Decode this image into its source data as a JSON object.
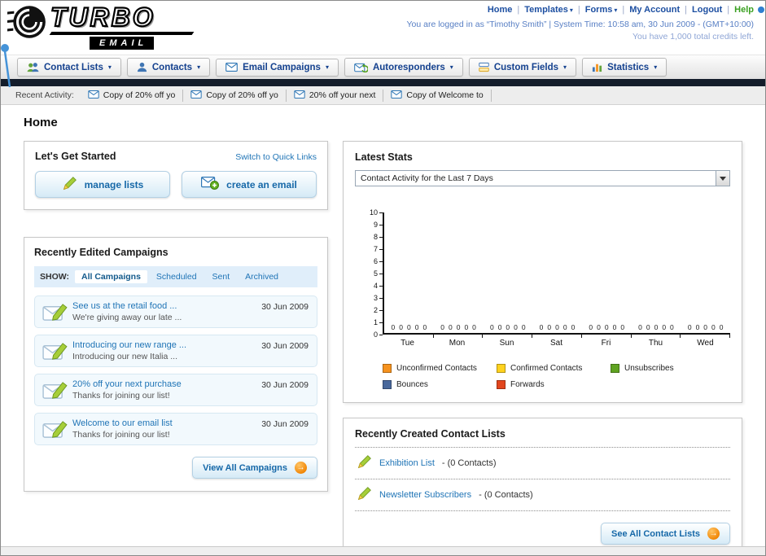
{
  "icons": {
    "caret_down": "▾",
    "arrow_right": "→"
  },
  "header": {
    "logo_line1": "TURBO",
    "logo_line2": "EMAIL",
    "nav_links": [
      "Home",
      "Templates",
      "Forms",
      "My Account",
      "Logout",
      "Help"
    ],
    "login_status": "You are logged in as “Timothy Smith” | System Time: 10:58 am, 30 Jun 2009 - (GMT+10:00)",
    "credits": "You have 1,000 total credits left."
  },
  "nav_tabs": [
    {
      "label": "Contact Lists"
    },
    {
      "label": "Contacts"
    },
    {
      "label": "Email Campaigns"
    },
    {
      "label": "Autoresponders"
    },
    {
      "label": "Custom Fields"
    },
    {
      "label": "Statistics"
    }
  ],
  "recent_activity": {
    "label": "Recent Activity:",
    "items": [
      "Copy of 20% off yo",
      "Copy of 20% off yo",
      "20% off your next",
      "Copy of Welcome to"
    ]
  },
  "page_title": "Home",
  "get_started": {
    "title": "Let's Get Started",
    "switch_link": "Switch to Quick Links",
    "manage_lists": "manage lists",
    "create_email": "create an email"
  },
  "campaigns": {
    "title": "Recently Edited Campaigns",
    "show_label": "SHOW:",
    "filters": [
      {
        "label": "All Campaigns",
        "active": true
      },
      {
        "label": "Scheduled",
        "active": false
      },
      {
        "label": "Sent",
        "active": false
      },
      {
        "label": "Archived",
        "active": false
      }
    ],
    "items": [
      {
        "title": "See us at the retail food ...",
        "subtitle": "We're giving away our late ...",
        "date": "30 Jun 2009"
      },
      {
        "title": "Introducing our new range ...",
        "subtitle": "Introducing our new Italia ...",
        "date": "30 Jun 2009"
      },
      {
        "title": "20% off your next purchase",
        "subtitle": "Thanks for joining our list!",
        "date": "30 Jun 2009"
      },
      {
        "title": "Welcome to our email list",
        "subtitle": "Thanks for joining our list!",
        "date": "30 Jun 2009"
      }
    ],
    "view_all_label": "View All Campaigns"
  },
  "stats": {
    "title": "Latest Stats",
    "dropdown_value": "Contact Activity for the Last 7 Days",
    "chart_data": {
      "type": "bar",
      "title": "Contact Activity for the Last 7 Days",
      "categories": [
        "Tue",
        "Mon",
        "Sun",
        "Sat",
        "Fri",
        "Thu",
        "Wed"
      ],
      "series": [
        {
          "name": "Unconfirmed Contacts",
          "color": "#f6921e",
          "values": [
            0,
            0,
            0,
            0,
            0,
            0,
            0
          ]
        },
        {
          "name": "Confirmed Contacts",
          "color": "#ffd21e",
          "values": [
            0,
            0,
            0,
            0,
            0,
            0,
            0
          ]
        },
        {
          "name": "Unsubscribes",
          "color": "#5fa321",
          "values": [
            0,
            0,
            0,
            0,
            0,
            0,
            0
          ]
        },
        {
          "name": "Bounces",
          "color": "#49689c",
          "values": [
            0,
            0,
            0,
            0,
            0,
            0,
            0
          ]
        },
        {
          "name": "Forwards",
          "color": "#e2461d",
          "values": [
            0,
            0,
            0,
            0,
            0,
            0,
            0
          ]
        }
      ],
      "ylim": [
        0,
        10
      ],
      "yticks": [
        0,
        1,
        2,
        3,
        4,
        5,
        6,
        7,
        8,
        9,
        10
      ],
      "grid": false,
      "legend_position": "bottom"
    }
  },
  "contact_lists": {
    "title": "Recently Created Contact Lists",
    "items": [
      {
        "name": "Exhibition List",
        "detail": "- (0 Contacts)"
      },
      {
        "name": "Newsletter Subscribers",
        "detail": "- (0 Contacts)"
      }
    ],
    "see_all_label": "See All Contact Lists"
  },
  "colors": {
    "link_blue": "#1f74b6",
    "nav_tab_text": "#14418f",
    "dark_bar": "#141d2b",
    "button_blue_text": "#1668a8",
    "help_link_green": "#3aa021",
    "button_arrow_orange": "#f08300"
  }
}
